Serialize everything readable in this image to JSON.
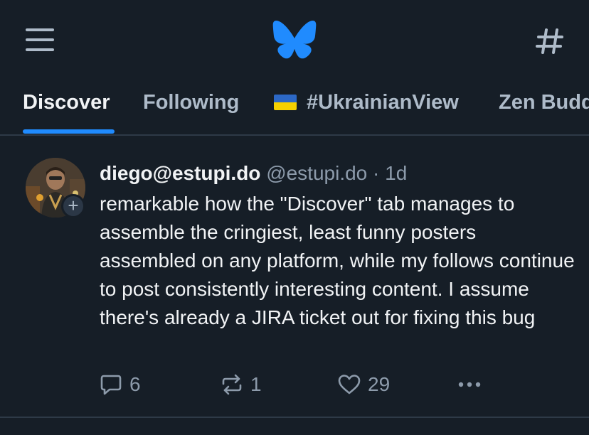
{
  "header": {
    "menu_icon": "hamburger-menu-icon",
    "logo_icon": "butterfly-logo-icon",
    "feeds_icon": "hashtag-icon",
    "accent_color": "#208bfe"
  },
  "tabs": [
    {
      "label": "Discover",
      "active": true
    },
    {
      "label": "Following",
      "active": false
    },
    {
      "label": "#UkrainianView",
      "active": false,
      "flag": "ukraine-flag"
    },
    {
      "label": "Zen Budd",
      "active": false
    }
  ],
  "post": {
    "display_name": "diego@estupi.do",
    "handle": "@estupi.do",
    "separator": "·",
    "time": "1d",
    "text": "remarkable how the \"Discover\" tab manages to assemble the cringiest, least funny posters assembled on any platform, while my follows continue to post consistently interesting content. I assume there's already a JIRA ticket out for fixing this bug",
    "follow_label": "+",
    "actions": {
      "replies": "6",
      "reposts": "1",
      "likes": "29"
    }
  }
}
